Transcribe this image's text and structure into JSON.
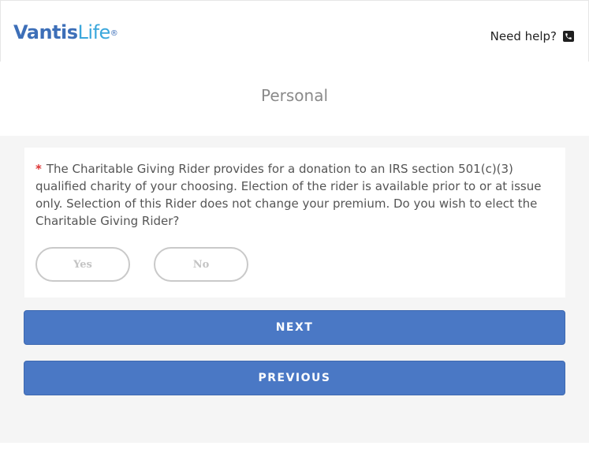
{
  "header": {
    "logo_part1": "Vantis",
    "logo_part2": "Life",
    "logo_reg": "®",
    "help_text": "Need help?",
    "help_icon": "phone-icon"
  },
  "page": {
    "title": "Personal"
  },
  "question": {
    "required_marker": "*",
    "text": "The Charitable Giving Rider provides for a donation to an IRS section 501(c)(3) qualified charity of your choosing. Election of the rider is available prior to or at issue only. Selection of this Rider does not change your premium. Do you wish to elect the Charitable Giving Rider?",
    "options": [
      "Yes",
      "No"
    ]
  },
  "nav": {
    "next_label": "NEXT",
    "previous_label": "PREVIOUS"
  },
  "colors": {
    "brand_dark": "#3d6fb8",
    "brand_light": "#3aa7dc",
    "button": "#4a78c5",
    "required": "#dd3333"
  }
}
